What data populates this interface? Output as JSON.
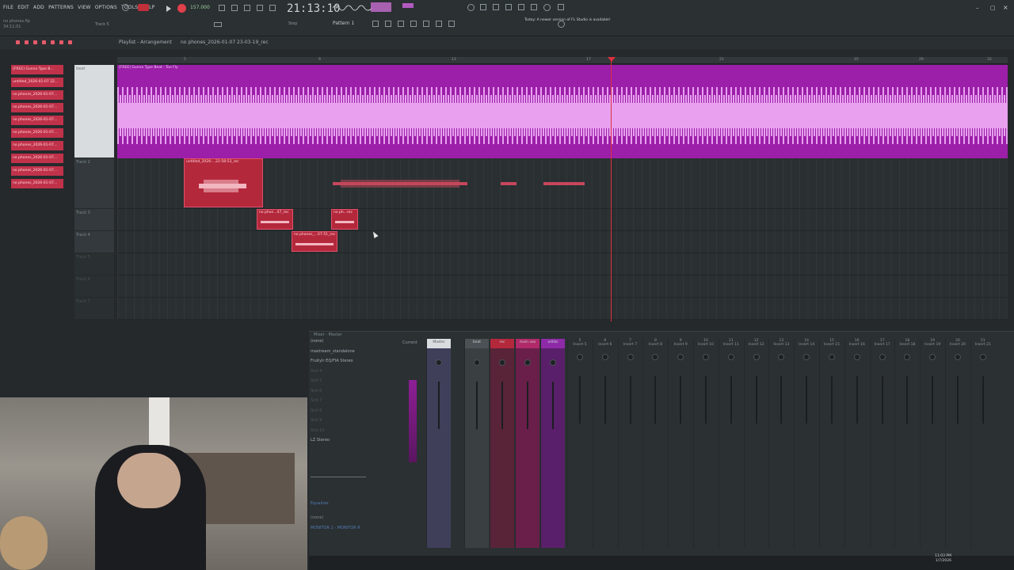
{
  "app": {
    "menu": [
      "FILE",
      "EDIT",
      "ADD",
      "PATTERNS",
      "VIEW",
      "OPTIONS",
      "TOOLS",
      "HELP"
    ],
    "project_name": "no phones.flp",
    "project_time": "34:11:01",
    "tempo": "157.000",
    "clock": "21:13:10",
    "pattern_selector": "Pattern 1",
    "snap_label": "Step",
    "track_label_top": "Track 5",
    "update_notice": "Today: A newer version of FL Studio is available!"
  },
  "playlist": {
    "title": "Playlist - Arrangement",
    "arrangement_name": "no phones_2026-01-07 23-03-19_rec",
    "ruler_numbers": [
      "5",
      "9",
      "13",
      "17",
      "21",
      "25",
      "29",
      "33"
    ],
    "patterns": [
      "[FREE] Gunna Type B...",
      "untitled_2026-01-07 22...",
      "no phones_2026-01-07...",
      "no phones_2026-01-07...",
      "no phones_2026-01-07...",
      "no phones_2026-01-07...",
      "no phones_2026-01-07...",
      "no phones_2026-01-07...",
      "no phones_2026-01-07...",
      "no phones_2026-01-07..."
    ],
    "tracks": [
      {
        "name": "beat"
      },
      {
        "name": "Track 2"
      },
      {
        "name": "Track 3"
      },
      {
        "name": "Track 4"
      },
      {
        "name": "Track 5"
      },
      {
        "name": "Track 6"
      },
      {
        "name": "Track 7"
      }
    ],
    "clips": {
      "main_audio": "[FREE] Gunna Type Beat - Too Fly",
      "track2_clip": "untitled_2026-...22-58-53_rec",
      "track3_clip_a": "no phon...47_rec",
      "track3_clip_b": "no ph...rec",
      "track4_clip": "no phones_...07-51_rec"
    }
  },
  "mixer": {
    "title": "Mixer - Master",
    "slots": [
      "(none)",
      "mastream_standalone",
      "FruityIr EQ/FIA Stereo",
      "Slot 4",
      "Slot 5",
      "Slot 6",
      "Slot 7",
      "Slot 8",
      "Slot 9",
      "Slot 10",
      "LZ Stereo"
    ],
    "equalizer_label": "Equalizer",
    "input_label": "(none)",
    "output_label": "MONITOR 1 - MONITOR R",
    "current_label": "Current",
    "master_label": "Master",
    "strips": [
      "beat",
      "rec",
      "main vox",
      "adlibs"
    ],
    "inserts": [
      "Insert 5",
      "Insert 6",
      "Insert 7",
      "Insert 8",
      "Insert 9",
      "Insert 10",
      "Insert 11",
      "Insert 12",
      "Insert 13",
      "Insert 14",
      "Insert 15",
      "Insert 16",
      "Insert 17",
      "Insert 18",
      "Insert 19",
      "Insert 20",
      "Insert 21"
    ],
    "insert_numbers": [
      "5",
      "6",
      "7",
      "8",
      "9",
      "10",
      "11",
      "12",
      "13",
      "14",
      "15",
      "16",
      "17",
      "18",
      "19",
      "20",
      "21"
    ]
  },
  "system": {
    "time": "11:03 PM",
    "date": "1/7/2026"
  },
  "colors": {
    "accent_purple": "#9b1fa8",
    "clip_red": "#b4283c",
    "playhead": "#e0303e"
  }
}
